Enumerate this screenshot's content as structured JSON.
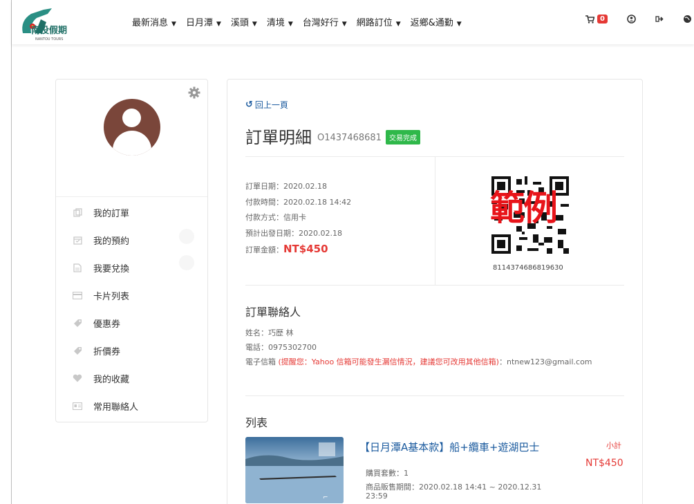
{
  "header": {
    "logo_text": "南投假期",
    "logo_sub": "NANTOU TOURS",
    "nav": [
      {
        "label": "最新消息"
      },
      {
        "label": "日月潭"
      },
      {
        "label": "溪頭"
      },
      {
        "label": "清境"
      },
      {
        "label": "台灣好行"
      },
      {
        "label": "網路訂位"
      },
      {
        "label": "返鄉&通勤"
      }
    ],
    "cart_count": "0"
  },
  "sidebar": {
    "items": [
      {
        "label": "我的訂單",
        "icon": "order-icon"
      },
      {
        "label": "我的預約",
        "icon": "calendar-icon"
      },
      {
        "label": "我要兌換",
        "icon": "document-icon"
      },
      {
        "label": "卡片列表",
        "icon": "card-icon"
      },
      {
        "label": "優惠券",
        "icon": "tag-icon"
      },
      {
        "label": "折價券",
        "icon": "tag-icon"
      },
      {
        "label": "我的收藏",
        "icon": "heart-icon"
      },
      {
        "label": "常用聯絡人",
        "icon": "contact-card-icon"
      }
    ]
  },
  "order": {
    "back_label": "回上一頁",
    "title": "訂單明細",
    "order_no": "O1437468681",
    "status": "交易完成",
    "order_date": "訂單日期：2020.02.18",
    "pay_time": "付款時間：2020.02.18 14:42",
    "pay_method": "付款方式：信用卡",
    "depart_date": "預計出發日期：2020.02.18",
    "amount_label": "訂單金額：",
    "amount": "NT$450",
    "qr_watermark": "範例",
    "qr_code": "8114374686819630"
  },
  "contact": {
    "title": "訂單聯絡人",
    "name": "姓名：巧歷 林",
    "phone": "電話：0975302700",
    "email_label": "電子信箱",
    "email_warning": "(提醒您：Yahoo 信箱可能發生漏信情況，建議您可改用其他信箱)",
    "email": "：ntnew123@gmail.com"
  },
  "list": {
    "title": "列表",
    "product_name": "【日月潭A基本款】船+纜車+遊湖巴士",
    "subtotal_label": "小計",
    "subtotal": "NT$450",
    "qty": "購買套數：1",
    "period": "商品販售期間：2020.02.18 14:41 ~ 2020.12.31 23:59"
  },
  "colors": {
    "link": "#1a5a9e",
    "price": "#e53935",
    "badge": "#2fb84a",
    "avatar": "#7a463a"
  }
}
